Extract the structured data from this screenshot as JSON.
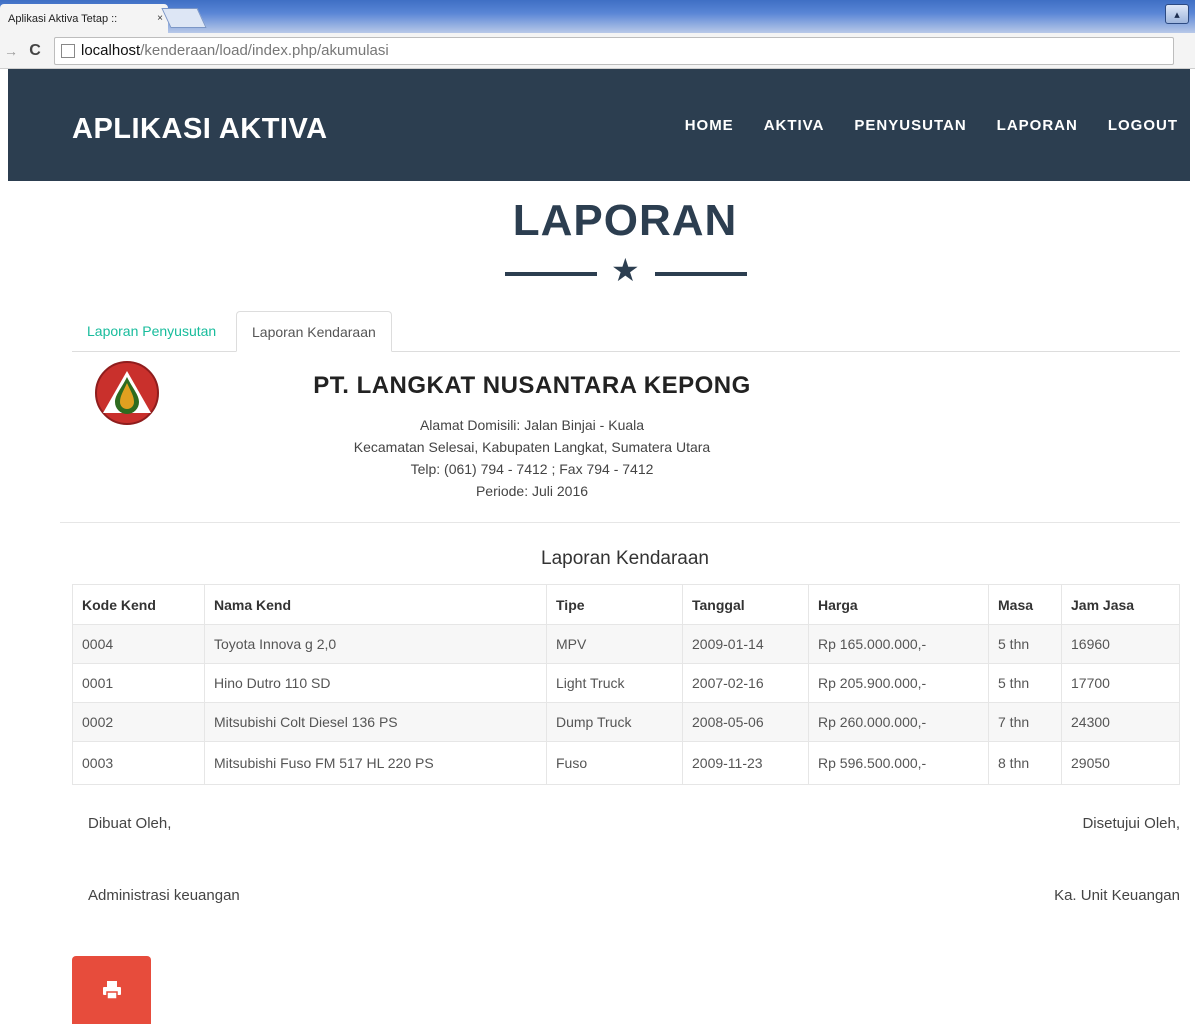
{
  "browser": {
    "tab_title": "Aplikasi Aktiva Tetap ::",
    "tab_close": "×",
    "url_host": "localhost",
    "url_path": "/kenderaan/load/index.php/akumulasi"
  },
  "nav": {
    "brand": "APLIKASI AKTIVA",
    "links": [
      "HOME",
      "AKTIVA",
      "PENYUSUTAN",
      "LAPORAN",
      "LOGOUT"
    ]
  },
  "page": {
    "title": "LAPORAN",
    "tabs": [
      "Laporan Penyusutan",
      "Laporan Kendaraan"
    ]
  },
  "company": {
    "name": "PT. LANGKAT NUSANTARA KEPONG",
    "address_lines": [
      "Alamat Domisili: Jalan Binjai - Kuala",
      "Kecamatan Selesai, Kabupaten Langkat, Sumatera Utara",
      "Telp: (061) 794 - 7412 ; Fax 794 - 7412",
      "Periode: Juli 2016"
    ]
  },
  "report": {
    "title": "Laporan Kendaraan",
    "headers": [
      "Kode Kend",
      "Nama Kend",
      "Tipe",
      "Tanggal",
      "Harga",
      "Masa",
      "Jam Jasa"
    ],
    "rows": [
      [
        "0004",
        "Toyota Innova g 2,0",
        "MPV",
        "2009-01-14",
        "Rp 165.000.000,-",
        "5 thn",
        "16960"
      ],
      [
        "0001",
        "Hino Dutro 110 SD",
        "Light Truck",
        "2007-02-16",
        "Rp 205.900.000,-",
        "5 thn",
        "17700"
      ],
      [
        "0002",
        "Mitsubishi Colt Diesel 136 PS",
        "Dump Truck",
        "2008-05-06",
        "Rp 260.000.000,-",
        "7 thn",
        "24300"
      ],
      [
        "0003",
        "Mitsubishi Fuso FM 517 HL 220 PS",
        "Fuso",
        "2009-11-23",
        "Rp 596.500.000,-",
        "8 thn",
        "29050"
      ]
    ]
  },
  "signatures": {
    "made_by": "Dibuat Oleh,",
    "approved_by": "Disetujui Oleh,",
    "maker_role": "Administrasi keuangan",
    "approver_role": "Ka. Unit Keuangan"
  },
  "colors": {
    "navbar": "#2c3e50",
    "accent": "#18bc9c",
    "print_button": "#e74c3c"
  }
}
